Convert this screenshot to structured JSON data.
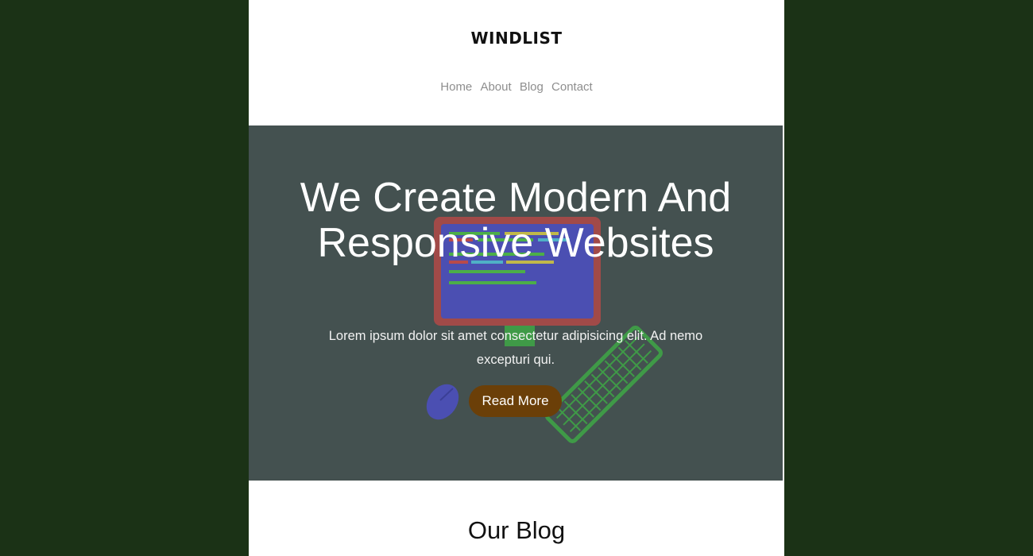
{
  "site": {
    "brand": "WINDLIST"
  },
  "nav": {
    "items": [
      {
        "label": "Home"
      },
      {
        "label": "About"
      },
      {
        "label": "Blog"
      },
      {
        "label": "Contact"
      }
    ]
  },
  "hero": {
    "title": "We Create Modern And Responsive Websites",
    "text": "Lorem ipsum dolor sit amet consectetur adipisicing elit. Ad nemo excepturi qui.",
    "button_label": "Read More"
  },
  "blog": {
    "title": "Our Blog"
  },
  "colors": {
    "page_background": "#1b3216",
    "content_background": "#ffffff",
    "hero_background": "#445150",
    "button_background": "#6b3f08",
    "nav_text": "#8e8e8e"
  },
  "icons": [
    "monitor-icon",
    "keyboard-icon",
    "mouse-icon"
  ]
}
